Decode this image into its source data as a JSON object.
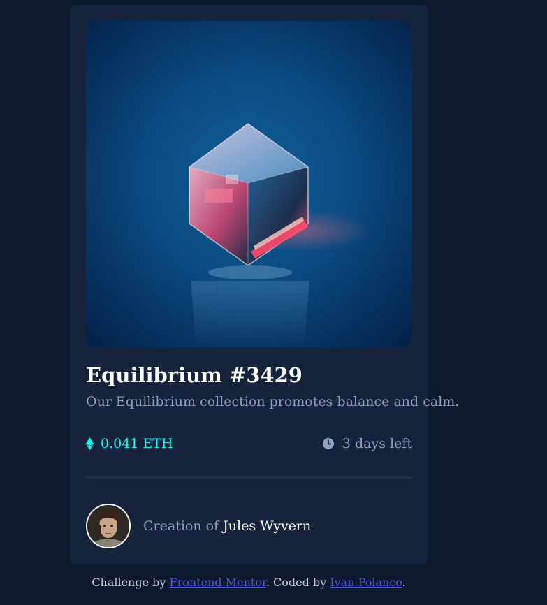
{
  "card": {
    "title": "Equilibrium #3429",
    "description": "Our Equilibrium collection promotes balance and calm.",
    "price": "0.041 ETH",
    "time_left": "3 days left",
    "creator_prefix": "Creation of ",
    "creator_name": "Jules Wyvern",
    "icons": [
      "ethereum-icon",
      "clock-icon"
    ]
  },
  "attribution": {
    "prefix": "Challenge by ",
    "link1": "Frontend Mentor",
    "middle": ". Coded by ",
    "link2": "Ivan Polanco",
    "suffix": "."
  },
  "colors": {
    "page_bg": "#0d192c",
    "card_bg": "#15233c",
    "cyan": "#00fff8",
    "soft_blue": "#8ea0bf",
    "white": "#ffffff",
    "link": "#4f58d6"
  }
}
